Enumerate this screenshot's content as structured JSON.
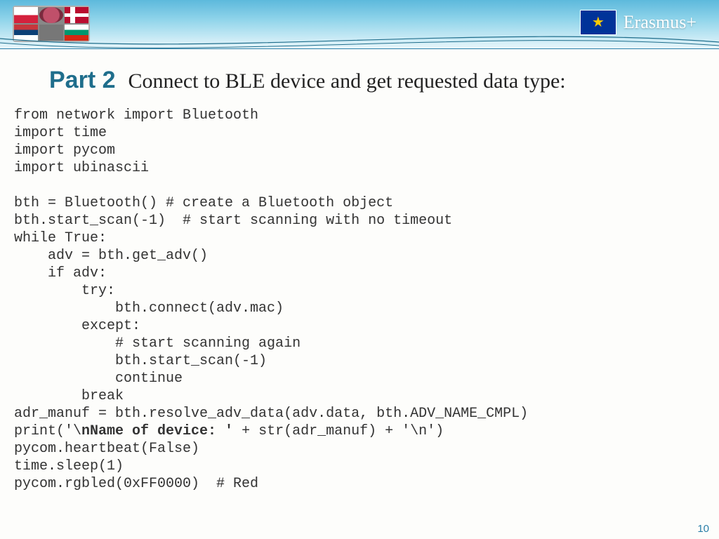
{
  "header": {
    "program_label": "Erasmus+",
    "eu_star": "★"
  },
  "title": {
    "part": "Part 2",
    "heading": "Connect to BLE device and get requested data type:"
  },
  "code": {
    "l01": "from network import Bluetooth",
    "l02": "import time",
    "l03": "import pycom",
    "l04": "import ubinascii",
    "l05": "",
    "l06": "bth = Bluetooth() # create a Bluetooth object",
    "l07": "bth.start_scan(-1)  # start scanning with no timeout",
    "l08": "while True:",
    "l09": "    adv = bth.get_adv()",
    "l10": "    if adv:",
    "l11": "        try:",
    "l12": "            bth.connect(adv.mac)",
    "l13": "        except:",
    "l14": "            # start scanning again",
    "l15": "            bth.start_scan(-1)",
    "l16": "            continue",
    "l17": "        break",
    "l18": "adr_manuf = bth.resolve_adv_data(adv.data, bth.ADV_NAME_CMPL)",
    "l19a": "print('\\",
    "l19b": "nName of device: '",
    "l19c": " + str(adr_manuf) + '\\n')",
    "l20": "pycom.heartbeat(False)",
    "l21": "time.sleep(1)",
    "l22": "pycom.rgbled(0xFF0000)  # Red"
  },
  "page_number": "10"
}
